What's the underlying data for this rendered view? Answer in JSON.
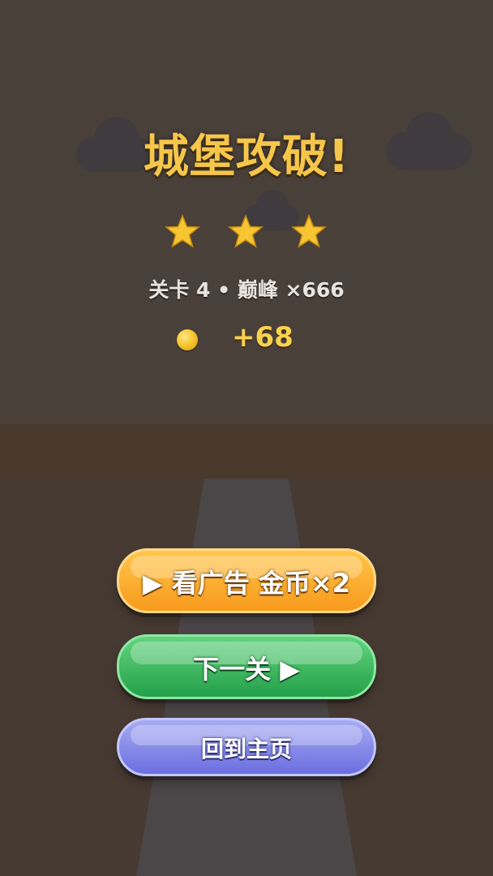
{
  "result": {
    "title": "城堡攻破!",
    "stars_earned": 3,
    "stars_total": 3,
    "level_text": "关卡 4 • 巅峰 ×666",
    "coin_reward": "+68"
  },
  "buttons": {
    "watch_ad": "▶ 看广告 金币×2",
    "next_level": "下一关 ▶",
    "home": "回到主页"
  },
  "icons": {
    "star": "star-icon",
    "coin": "coin-icon",
    "play": "play-icon"
  },
  "colors": {
    "title": "#f6c64a",
    "star": "#f7c531",
    "ad_button": "#f89a1c",
    "next_button": "#24a04a",
    "home_button": "#6b6ede"
  }
}
